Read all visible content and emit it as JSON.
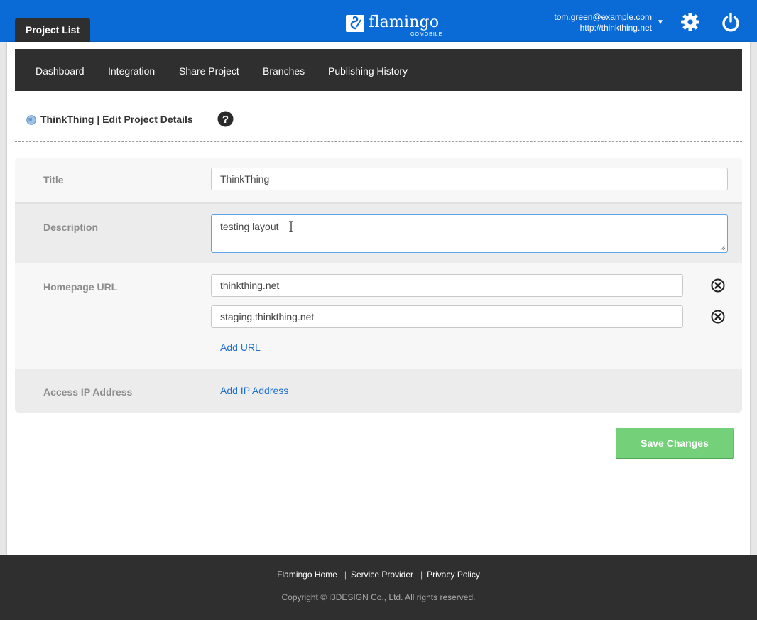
{
  "header": {
    "tab_label": "Project List",
    "logo_text": "flamingo",
    "logo_subtext": "GOMOBILE",
    "user_email": "tom.green@example.com",
    "user_site": "http://thinkthing.net",
    "caret": "▼",
    "icons": [
      "gear-icon",
      "power-icon"
    ]
  },
  "subnav": {
    "items": [
      "Dashboard",
      "Integration",
      "Share Project",
      "Branches",
      "Publishing History"
    ]
  },
  "page": {
    "title": "ThinkThing | Edit Project Details",
    "help_icon": "question-circle-icon"
  },
  "form": {
    "title_label": "Title",
    "title_value": "ThinkThing",
    "description_label": "Description",
    "description_value": "testing layout",
    "homepage_label": "Homepage URL",
    "urls": [
      "thinkthing.net",
      "staging.thinkthing.net"
    ],
    "add_url_label": "Add URL",
    "ip_label": "Access IP Address",
    "add_ip_label": "Add IP Address"
  },
  "actions": {
    "save_label": "Save Changes",
    "save_color": "#74d17a"
  },
  "footer": {
    "links": [
      "Flamingo Home",
      "Service Provider",
      "Privacy Policy"
    ],
    "copyright": "Copyright © i3DESIGN Co., Ltd. All rights reserved."
  },
  "colors": {
    "topbar": "#0a6ad6",
    "dark": "#2f2f2f",
    "link": "#1f6fcf"
  }
}
